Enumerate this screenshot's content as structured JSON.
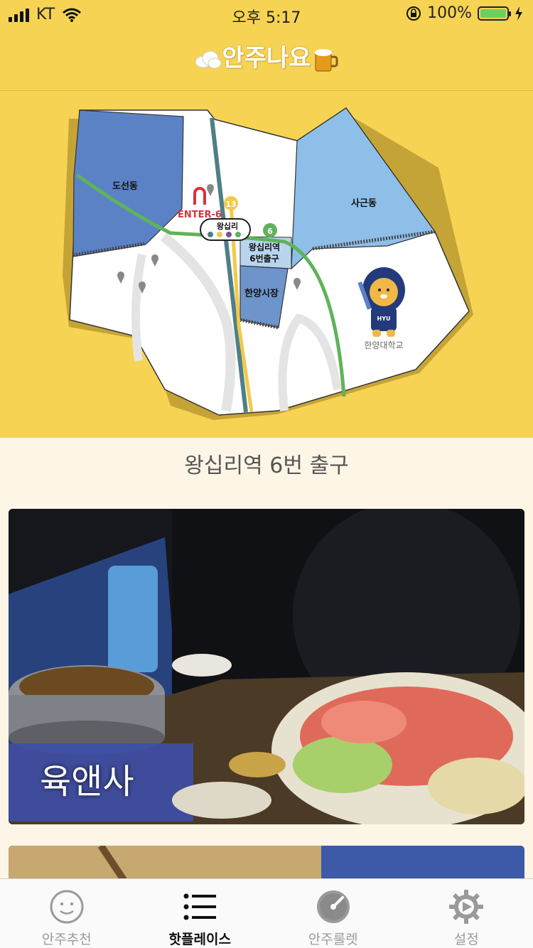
{
  "status": {
    "carrier": "KT",
    "time": "오후 5:17",
    "battery_pct": "100%"
  },
  "nav": {
    "title": "안주나요"
  },
  "map": {
    "labels": {
      "doseon": "도선동",
      "sageun": "사근동",
      "wangsimni": "왕십리",
      "exit6_line1": "왕십리역",
      "exit6_line2": "6번출구",
      "market": "한양시장",
      "enter6": "ENTER-6",
      "univ": "한양대학교",
      "line13": "13",
      "line6": "6",
      "mascot_badge": "HYU"
    },
    "colors": {
      "doseon_fill": "#5b82c4",
      "sageun_fill": "#8ebfe8",
      "exit_fill": "#b9d5ee",
      "market_fill": "#6d95cb",
      "line_green": "#5fb35a",
      "line_teal": "#4f7f86",
      "line_yellow": "#f2c94a"
    }
  },
  "section": {
    "title": "왕십리역 6번 출구"
  },
  "cards": [
    {
      "name": "육앤사"
    },
    {
      "name": ""
    }
  ],
  "tabs": [
    {
      "label": "안주추천",
      "icon": "smiley-icon"
    },
    {
      "label": "핫플레이스",
      "icon": "list-icon"
    },
    {
      "label": "안주룰렛",
      "icon": "roulette-icon"
    },
    {
      "label": "설정",
      "icon": "gear-icon"
    }
  ]
}
